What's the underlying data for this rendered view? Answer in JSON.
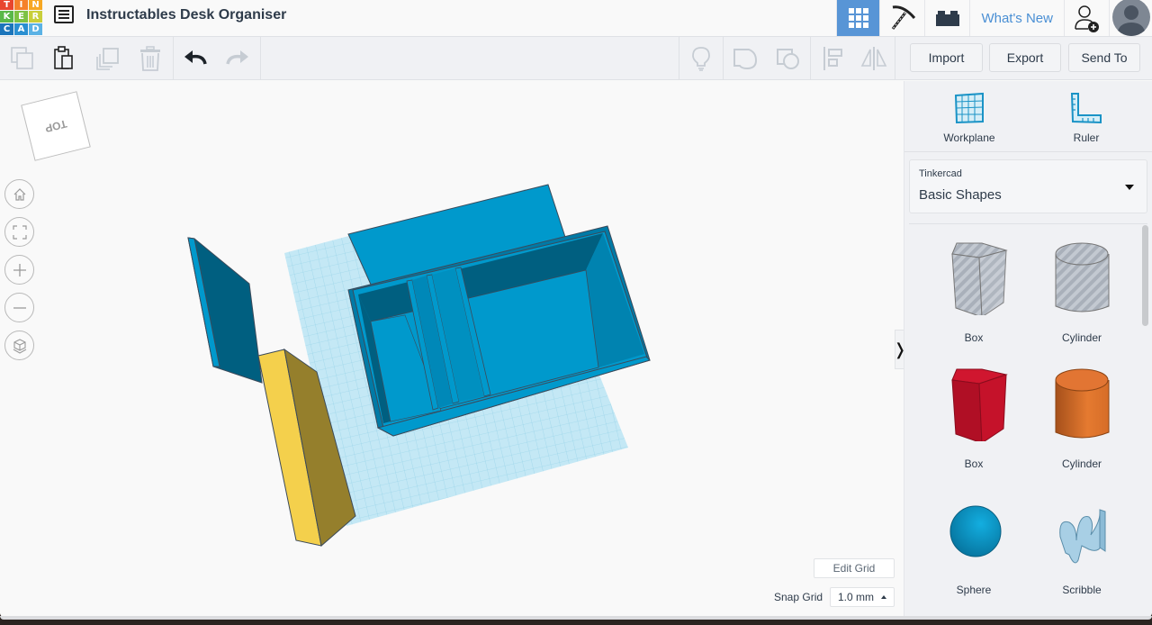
{
  "header": {
    "logo_letters": [
      "T",
      "I",
      "N",
      "K",
      "E",
      "R",
      "C",
      "A",
      "D"
    ],
    "logo_colors": [
      "#e8462e",
      "#f5812b",
      "#f7a823",
      "#59b849",
      "#7dc243",
      "#c9cf3a",
      "#1b75bb",
      "#2a8fd1",
      "#5bb2e5"
    ],
    "menu_icon": "list-icon",
    "title": "Instructables Desk Organiser",
    "nav": [
      {
        "name": "3d-design-view",
        "icon": "grid-icon",
        "active": true
      },
      {
        "name": "blocks-view",
        "icon": "pickaxe-icon",
        "active": false
      },
      {
        "name": "bricks-view",
        "icon": "brick-icon",
        "active": false
      }
    ],
    "whats_new": "What's New",
    "add_user_icon": "add-user-icon",
    "avatar_icon": "avatar-icon",
    "accent_color": "#5895d6"
  },
  "toolbar": {
    "left_tools": [
      {
        "name": "copy",
        "icon": "copy-icon",
        "enabled": false
      },
      {
        "name": "paste",
        "icon": "paste-icon",
        "enabled": true
      },
      {
        "name": "duplicate",
        "icon": "duplicate-icon",
        "enabled": false
      },
      {
        "name": "delete",
        "icon": "trash-icon",
        "enabled": false
      },
      {
        "name": "undo",
        "icon": "undo-icon",
        "enabled": true
      },
      {
        "name": "redo",
        "icon": "redo-icon",
        "enabled": false
      }
    ],
    "right_tools": [
      {
        "name": "notes",
        "icon": "lightbulb-icon",
        "enabled": false
      },
      {
        "name": "group",
        "icon": "group-icon",
        "enabled": false
      },
      {
        "name": "ungroup",
        "icon": "ungroup-icon",
        "enabled": false
      },
      {
        "name": "align",
        "icon": "align-icon",
        "enabled": false
      },
      {
        "name": "mirror",
        "icon": "mirror-icon",
        "enabled": false
      }
    ],
    "import_label": "Import",
    "export_label": "Export",
    "send_to_label": "Send To"
  },
  "canvas": {
    "viewcube_label": "TOP",
    "nav_buttons": [
      {
        "name": "home-view",
        "icon": "home-icon"
      },
      {
        "name": "fit-view",
        "icon": "fit-icon"
      },
      {
        "name": "zoom-in",
        "icon": "plus-icon"
      },
      {
        "name": "zoom-out",
        "icon": "minus-icon"
      },
      {
        "name": "perspective",
        "icon": "cube-icon"
      }
    ],
    "objects": [
      {
        "name": "blue-organiser-box",
        "color": "#0099cc"
      },
      {
        "name": "blue-lid-panel",
        "color": "#0099cc"
      },
      {
        "name": "blue-side-panel",
        "color": "#005f80"
      },
      {
        "name": "yellow-block",
        "color": "#f4d04c"
      }
    ],
    "edit_grid_label": "Edit Grid",
    "snap_grid_label": "Snap Grid",
    "snap_grid_value": "1.0 mm",
    "collapse_icon": "chevron-right-icon",
    "collapse_glyph": "❭"
  },
  "panel": {
    "workplane_label": "Workplane",
    "ruler_label": "Ruler",
    "library_source": "Tinkercad",
    "library_name": "Basic Shapes",
    "shapes": [
      {
        "label": "Box",
        "kind": "box-hole",
        "color": "#c0c6cf"
      },
      {
        "label": "Cylinder",
        "kind": "cylinder-hole",
        "color": "#c0c6cf"
      },
      {
        "label": "Box",
        "kind": "box",
        "color": "#c8102e"
      },
      {
        "label": "Cylinder",
        "kind": "cylinder",
        "color": "#e2712a"
      },
      {
        "label": "Sphere",
        "kind": "sphere",
        "color": "#0a9bd0"
      },
      {
        "label": "Scribble",
        "kind": "scribble",
        "color": "#9fc8e0"
      }
    ]
  }
}
